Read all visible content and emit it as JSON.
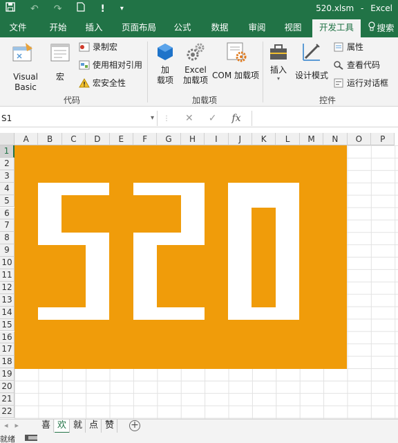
{
  "window": {
    "file_name": "520.xlsm",
    "separator": "-",
    "app_name": "Excel"
  },
  "quick_access": {
    "save_icon": "save-icon",
    "undo_icon": "undo-icon",
    "redo_icon": "redo-icon",
    "new_icon": "new-file-icon",
    "touch_icon": "touch-mode-icon",
    "customize_icon": "customize-qat-icon"
  },
  "tabs": [
    "文件",
    "开始",
    "插入",
    "页面布局",
    "公式",
    "数据",
    "审阅",
    "视图",
    "开发工具"
  ],
  "active_tab": "开发工具",
  "search_label": "搜索",
  "ribbon": {
    "code": {
      "label": "代码",
      "visual_basic": "Visual Basic",
      "macros": "宏",
      "record_macro": "录制宏",
      "relative_refs": "使用相对引用",
      "macro_security": "宏安全性"
    },
    "addins": {
      "label": "加载项",
      "addins_line1": "加",
      "addins_line2": "载项",
      "excel_addins_line1": "Excel",
      "excel_addins_line2": "加载项",
      "com_addins": "COM 加载项"
    },
    "controls": {
      "label": "控件",
      "insert": "插入",
      "design_mode": "设计模式",
      "properties": "属性",
      "view_code": "查看代码",
      "run_dialog": "运行对话框"
    }
  },
  "formula_bar": {
    "name_box": "S1",
    "cancel_symbol": "✕",
    "enter_symbol": "✓",
    "fx_symbol": "fx",
    "formula": ""
  },
  "columns": [
    "A",
    "B",
    "C",
    "D",
    "E",
    "F",
    "G",
    "H",
    "I",
    "J",
    "K",
    "L",
    "M",
    "N",
    "O",
    "P"
  ],
  "rows": [
    "1",
    "2",
    "3",
    "4",
    "5",
    "6",
    "7",
    "8",
    "9",
    "10",
    "11",
    "12",
    "13",
    "14",
    "15",
    "16",
    "17",
    "18",
    "19",
    "20",
    "21",
    "22"
  ],
  "selected_row": "1",
  "artwork": {
    "text": "520",
    "fill_color": "#f09c0a",
    "text_color": "#ffffff"
  },
  "sheets": [
    "喜",
    "欢",
    "就",
    "点",
    "赞"
  ],
  "active_sheet": "欢",
  "status": {
    "ready": "就绪"
  },
  "colors": {
    "accent": "#217346",
    "ribbon_bg": "#f3f3f3"
  }
}
